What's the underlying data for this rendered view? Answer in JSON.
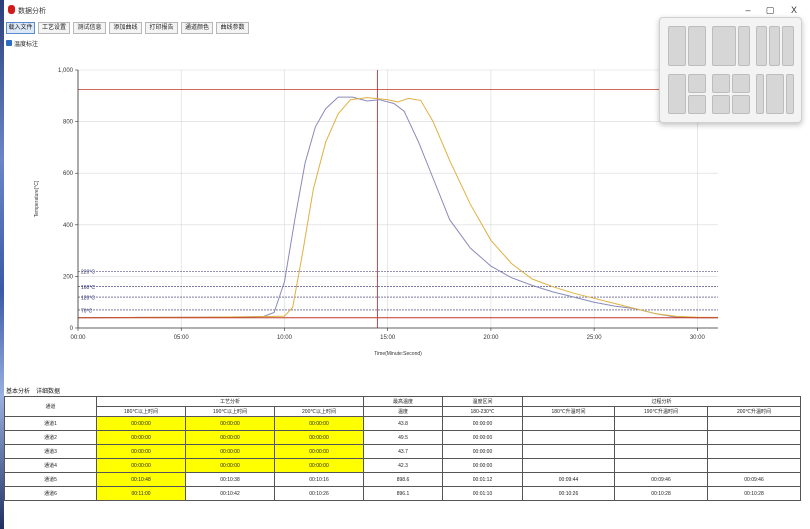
{
  "app": {
    "title": "数据分析",
    "minimize": "–",
    "maximize": "▢",
    "close": "X"
  },
  "toolbar": [
    {
      "label": "载入文件",
      "active": true
    },
    {
      "label": "工艺设置",
      "active": false
    },
    {
      "label": "测试信息",
      "active": false
    },
    {
      "label": "添加曲线",
      "active": false
    },
    {
      "label": "打印报告",
      "active": false
    },
    {
      "label": "通道颜色",
      "active": false
    },
    {
      "label": "曲线参数",
      "active": false
    }
  ],
  "subbar": {
    "label": "温度标注"
  },
  "chart_data": {
    "type": "line",
    "xlabel": "Time(Minute:Second)",
    "ylabel": "Temperature[°C]",
    "xlim": [
      0,
      31
    ],
    "ylim": [
      0,
      1000
    ],
    "x_ticks": [
      {
        "v": 0,
        "label": "00:00"
      },
      {
        "v": 5,
        "label": "05:00"
      },
      {
        "v": 10,
        "label": "10:00"
      },
      {
        "v": 15,
        "label": "15:00"
      },
      {
        "v": 20,
        "label": "20:00"
      },
      {
        "v": 25,
        "label": "25:00"
      },
      {
        "v": 30,
        "label": "30:00"
      }
    ],
    "y_ticks": [
      {
        "v": 0,
        "label": "0"
      },
      {
        "v": 200,
        "label": "200"
      },
      {
        "v": 400,
        "label": "400"
      },
      {
        "v": 600,
        "label": "600"
      },
      {
        "v": 800,
        "label": "800"
      },
      {
        "v": 1000,
        "label": "1,000"
      }
    ],
    "grid": true,
    "ref_lines": [
      {
        "y": 220,
        "label": "220°C"
      },
      {
        "y": 160,
        "label": "160°C"
      },
      {
        "y": 120,
        "label": "120°C"
      },
      {
        "y": 70,
        "label": "70°C"
      }
    ],
    "limit_line": {
      "y": 925,
      "color": "#c0392b"
    },
    "cursor_x": 14.5,
    "series": [
      {
        "color": "#8a8ab8",
        "points": [
          [
            0,
            40
          ],
          [
            3,
            41
          ],
          [
            6,
            42
          ],
          [
            8,
            43
          ],
          [
            9,
            45
          ],
          [
            9.5,
            60
          ],
          [
            10,
            180
          ],
          [
            10.5,
            420
          ],
          [
            11,
            640
          ],
          [
            11.5,
            780
          ],
          [
            12,
            850
          ],
          [
            12.6,
            895
          ],
          [
            13.3,
            895
          ],
          [
            14,
            880
          ],
          [
            14.6,
            885
          ],
          [
            15.3,
            870
          ],
          [
            15.8,
            840
          ],
          [
            16.5,
            720
          ],
          [
            17.3,
            560
          ],
          [
            18,
            420
          ],
          [
            19,
            310
          ],
          [
            20,
            240
          ],
          [
            21,
            195
          ],
          [
            22,
            165
          ],
          [
            23,
            140
          ],
          [
            24,
            120
          ],
          [
            25,
            100
          ],
          [
            26,
            85
          ],
          [
            27,
            75
          ],
          [
            28,
            55
          ],
          [
            29,
            42
          ],
          [
            30,
            40
          ],
          [
            31,
            40
          ]
        ]
      },
      {
        "color": "#e0b040",
        "points": [
          [
            0,
            40
          ],
          [
            3,
            41
          ],
          [
            6,
            42
          ],
          [
            8,
            43
          ],
          [
            9,
            44
          ],
          [
            10,
            46
          ],
          [
            10.4,
            80
          ],
          [
            10.9,
            300
          ],
          [
            11.4,
            540
          ],
          [
            12,
            720
          ],
          [
            12.6,
            830
          ],
          [
            13.2,
            885
          ],
          [
            14,
            893
          ],
          [
            15,
            885
          ],
          [
            15.5,
            876
          ],
          [
            16,
            890
          ],
          [
            16.6,
            882
          ],
          [
            17.2,
            800
          ],
          [
            18,
            650
          ],
          [
            19,
            480
          ],
          [
            20,
            340
          ],
          [
            21,
            250
          ],
          [
            22,
            190
          ],
          [
            23,
            160
          ],
          [
            24,
            135
          ],
          [
            25,
            115
          ],
          [
            26,
            95
          ],
          [
            27,
            75
          ],
          [
            28,
            55
          ],
          [
            29,
            45
          ],
          [
            30,
            42
          ],
          [
            31,
            41
          ]
        ]
      },
      {
        "color": "#c0392b",
        "points": [
          [
            0,
            40
          ],
          [
            5,
            40
          ],
          [
            10,
            40
          ],
          [
            15,
            40
          ],
          [
            20,
            40
          ],
          [
            25,
            40
          ],
          [
            31,
            40
          ]
        ]
      }
    ]
  },
  "tabs": [
    "基本分析",
    "详细数据"
  ],
  "table": {
    "channel_header": "通道",
    "groups": [
      {
        "label": "工艺分析",
        "span": 3
      },
      {
        "label": "最高温度",
        "span": 1
      },
      {
        "label": "温度区间",
        "span": 1
      },
      {
        "label": "过程分析",
        "span": 3
      }
    ],
    "subheaders": [
      "180℃以上时间",
      "190℃以上时间",
      "200℃以上时间",
      "温度",
      "180-230℃",
      "180℃升温时间",
      "190℃升温时间",
      "200℃升温时间"
    ],
    "rows": [
      {
        "ch": "通道1",
        "cells": [
          "00:00:00",
          "00:00:00",
          "00:00:00",
          "43.8",
          "00:00:00",
          "",
          "",
          ""
        ]
      },
      {
        "ch": "通道2",
        "cells": [
          "00:00:00",
          "00:00:00",
          "00:00:00",
          "49.5",
          "00:00:00",
          "",
          "",
          ""
        ]
      },
      {
        "ch": "通道3",
        "cells": [
          "00:00:00",
          "00:00:00",
          "00:00:00",
          "43.7",
          "00:00:00",
          "",
          "",
          ""
        ]
      },
      {
        "ch": "通道4",
        "cells": [
          "00:00:00",
          "00:00:00",
          "00:00:00",
          "42.3",
          "00:00:00",
          "",
          "",
          ""
        ]
      },
      {
        "ch": "通道5",
        "cells": [
          "00:10:48",
          "00:10:38",
          "00:10:16",
          "898.6",
          "00:01:12",
          "00:09:44",
          "00:09:46",
          "00:09:46"
        ]
      },
      {
        "ch": "通道6",
        "cells": [
          "00:11:00",
          "00:10:42",
          "00:10:26",
          "896.1",
          "00:01:10",
          "00:10:26",
          "00:10:28",
          "00:10:28"
        ]
      }
    ]
  }
}
